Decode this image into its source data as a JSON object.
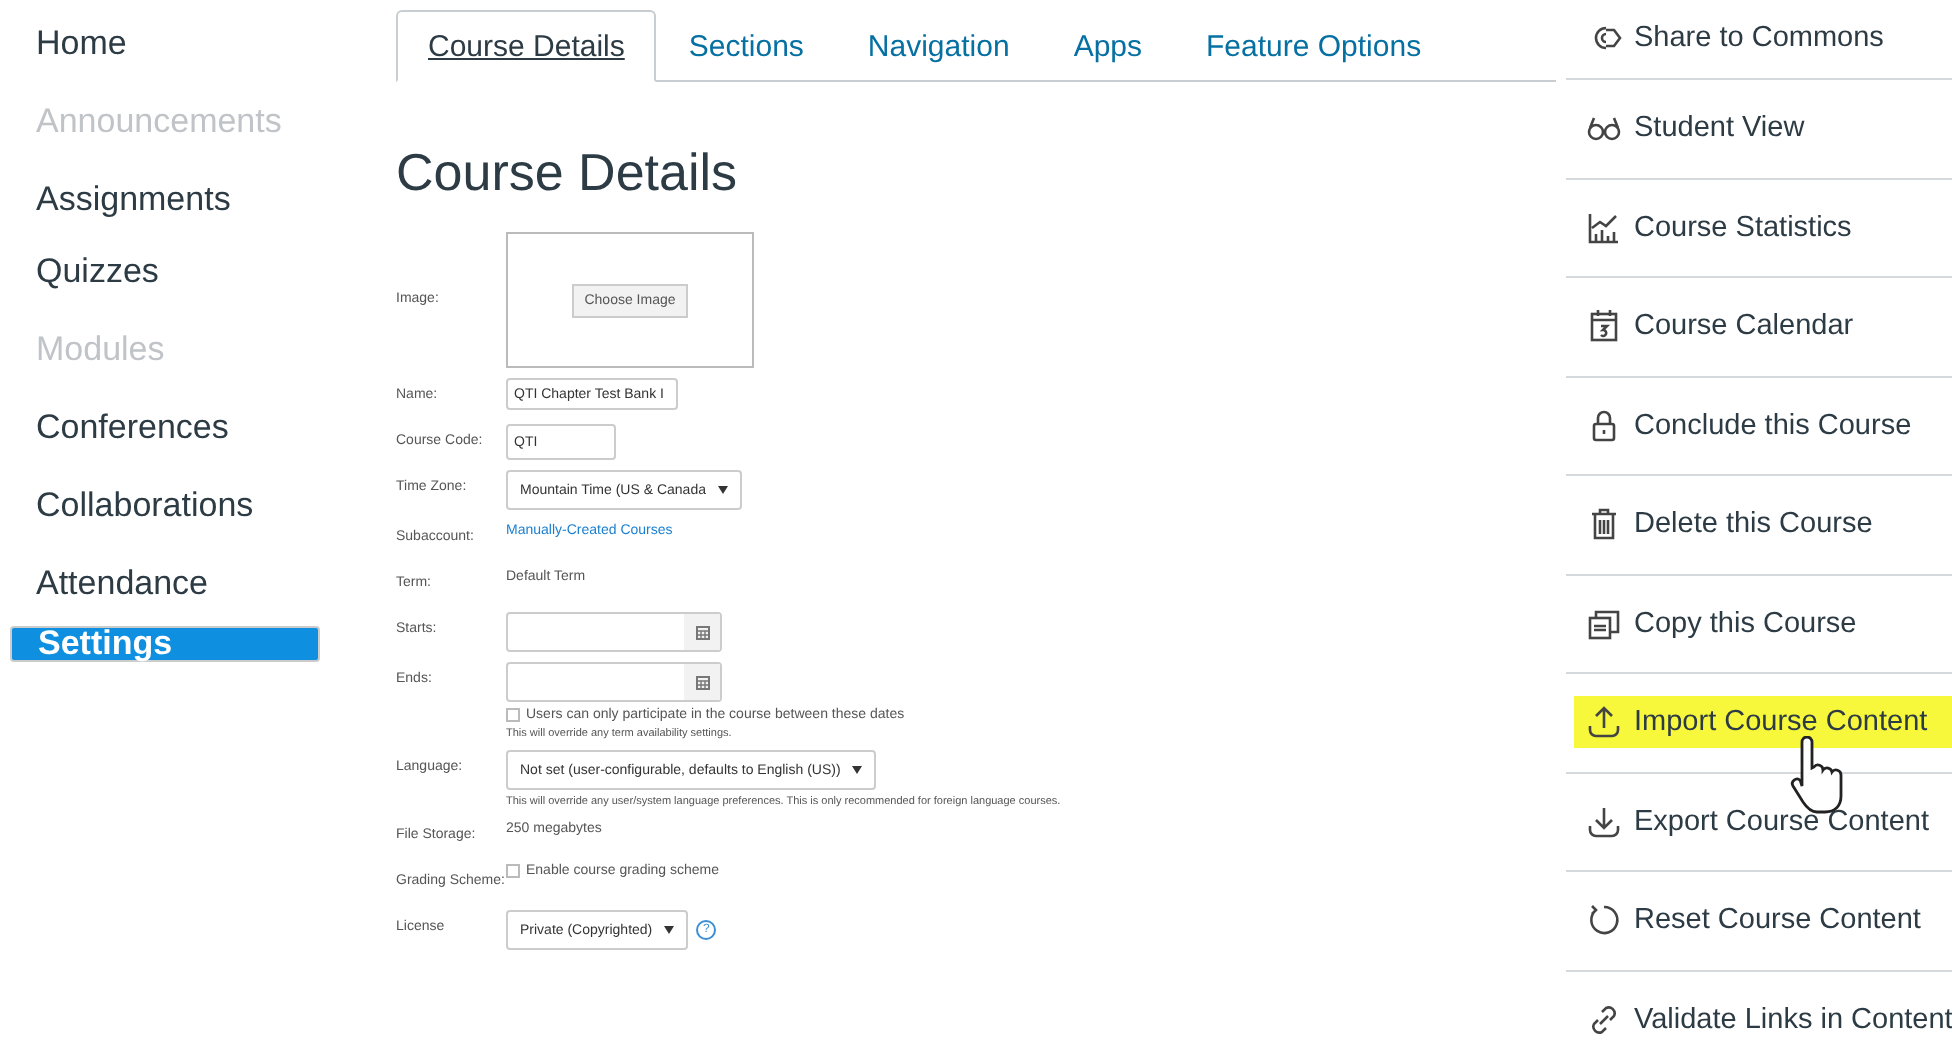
{
  "sidebar": {
    "items": [
      {
        "label": "Home",
        "disabled": false,
        "selected": false
      },
      {
        "label": "Announcements",
        "disabled": true,
        "selected": false
      },
      {
        "label": "Assignments",
        "disabled": false,
        "selected": false
      },
      {
        "label": "Quizzes",
        "disabled": false,
        "selected": false
      },
      {
        "label": "Modules",
        "disabled": true,
        "selected": false
      },
      {
        "label": "Conferences",
        "disabled": false,
        "selected": false
      },
      {
        "label": "Collaborations",
        "disabled": false,
        "selected": false
      },
      {
        "label": "Attendance",
        "disabled": false,
        "selected": false
      },
      {
        "label": "Settings",
        "disabled": false,
        "selected": true
      }
    ]
  },
  "tabs": [
    {
      "label": "Course Details",
      "selected": true
    },
    {
      "label": "Sections",
      "selected": false
    },
    {
      "label": "Navigation",
      "selected": false
    },
    {
      "label": "Apps",
      "selected": false
    },
    {
      "label": "Feature Options",
      "selected": false
    }
  ],
  "heading": "Course Details",
  "form": {
    "rows": [
      {
        "kind": "image",
        "label": "Image:",
        "button": "Choose Image"
      },
      {
        "kind": "text",
        "label": "Name:",
        "value": "QTI Chapter Test Bank I"
      },
      {
        "kind": "text",
        "label": "Course Code:",
        "value": "QTI"
      },
      {
        "kind": "select",
        "label": "Time Zone:",
        "value": "Mountain Time (US & Canada"
      },
      {
        "kind": "link",
        "label": "Subaccount:",
        "value": "Manually-Created Courses"
      },
      {
        "kind": "plain",
        "label": "Term:",
        "value": "Default Term"
      },
      {
        "kind": "date",
        "label": "Starts:"
      },
      {
        "kind": "date",
        "label": "Ends:",
        "checkbox": {
          "label": "Users can only participate in the course between these dates",
          "checked": false
        },
        "note": "This will override any term availability settings."
      },
      {
        "kind": "select",
        "label": "Language:",
        "value": "Not set (user-configurable, defaults to English (US))",
        "note": "This will override any user/system language preferences. This is only recommended for foreign language courses."
      },
      {
        "kind": "plain",
        "label": "File Storage:",
        "value": "250 megabytes"
      },
      {
        "kind": "check",
        "label": "Grading Scheme:",
        "checkbox": {
          "label": "Enable course grading scheme",
          "checked": false
        }
      },
      {
        "kind": "select",
        "label": "License",
        "value": "Private (Copyrighted)",
        "help": "?"
      }
    ]
  },
  "actions": [
    {
      "label": "Share to Commons",
      "highlighted": false
    },
    {
      "label": "Student View",
      "highlighted": false
    },
    {
      "label": "Course Statistics",
      "highlighted": false
    },
    {
      "label": "Course Calendar",
      "highlighted": false
    },
    {
      "label": "Conclude this Course",
      "highlighted": false
    },
    {
      "label": "Delete this Course",
      "highlighted": false
    },
    {
      "label": "Copy this Course",
      "highlighted": false
    },
    {
      "label": "Import Course Content",
      "highlighted": true
    },
    {
      "label": "Export Course Content",
      "highlighted": false
    },
    {
      "label": "Reset Course Content",
      "highlighted": false
    },
    {
      "label": "Validate Links in Content",
      "highlighted": false
    }
  ]
}
